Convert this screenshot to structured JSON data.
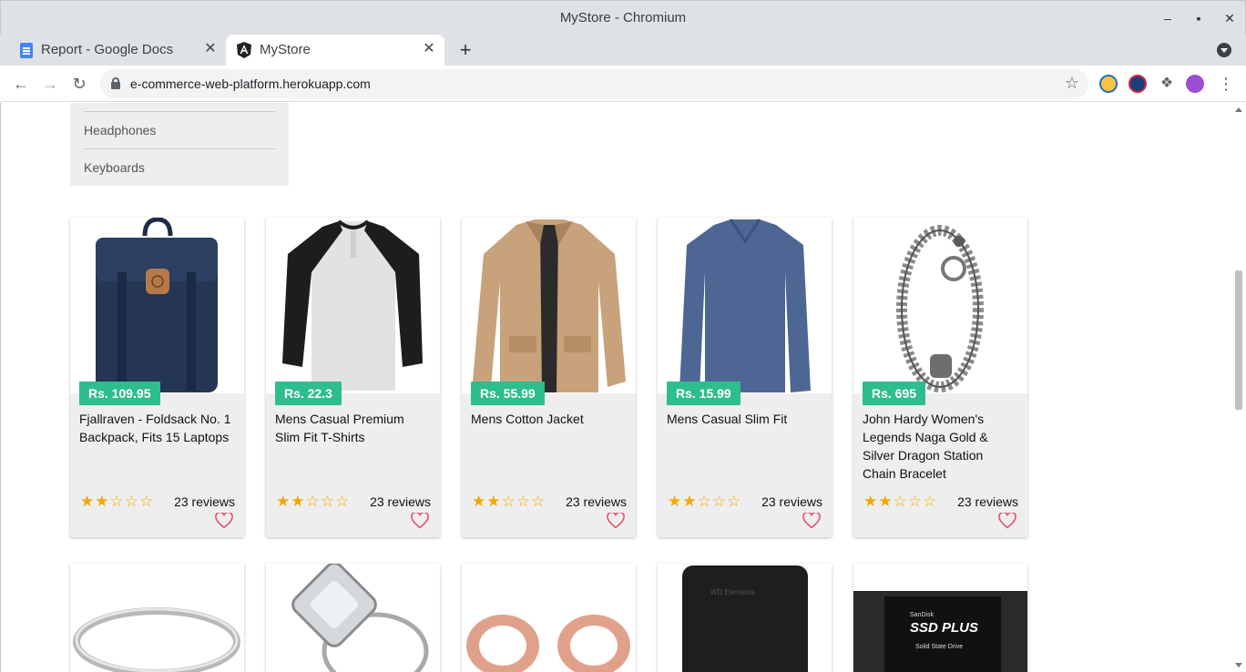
{
  "window": {
    "title": "MyStore - Chromium"
  },
  "tabs": [
    {
      "label": "Report - Google Docs",
      "icon": "google-docs-icon"
    },
    {
      "label": "MyStore",
      "icon": "angular-icon"
    }
  ],
  "toolbar": {
    "url": "e-commerce-web-platform.herokuapp.com"
  },
  "categories": {
    "items": [
      "Headphones",
      "Keyboards"
    ]
  },
  "products": [
    {
      "price": "Rs. 109.95",
      "name": "Fjallraven - Foldsack No. 1 Backpack, Fits 15 Laptops",
      "rating": 2,
      "reviews": "23 reviews"
    },
    {
      "price": "Rs. 22.3",
      "name": "Mens Casual Premium Slim Fit T-Shirts",
      "rating": 2,
      "reviews": "23 reviews"
    },
    {
      "price": "Rs. 55.99",
      "name": "Mens Cotton Jacket",
      "rating": 2,
      "reviews": "23 reviews"
    },
    {
      "price": "Rs. 15.99",
      "name": "Mens Casual Slim Fit",
      "rating": 2,
      "reviews": "23 reviews"
    },
    {
      "price": "Rs. 695",
      "name": "John Hardy Women's Legends Naga Gold & Silver Dragon Station Chain Bracelet",
      "rating": 2,
      "reviews": "23 reviews"
    }
  ],
  "ssd_label": {
    "brand": "SanDisk",
    "title": "SSD PLUS",
    "sub": "Solid State Drive"
  },
  "hdd_label": {
    "brand": "WD Elements"
  },
  "colors": {
    "price_badge": "#2ebd8d",
    "star": "#f4a700",
    "heart": "#e05570"
  }
}
